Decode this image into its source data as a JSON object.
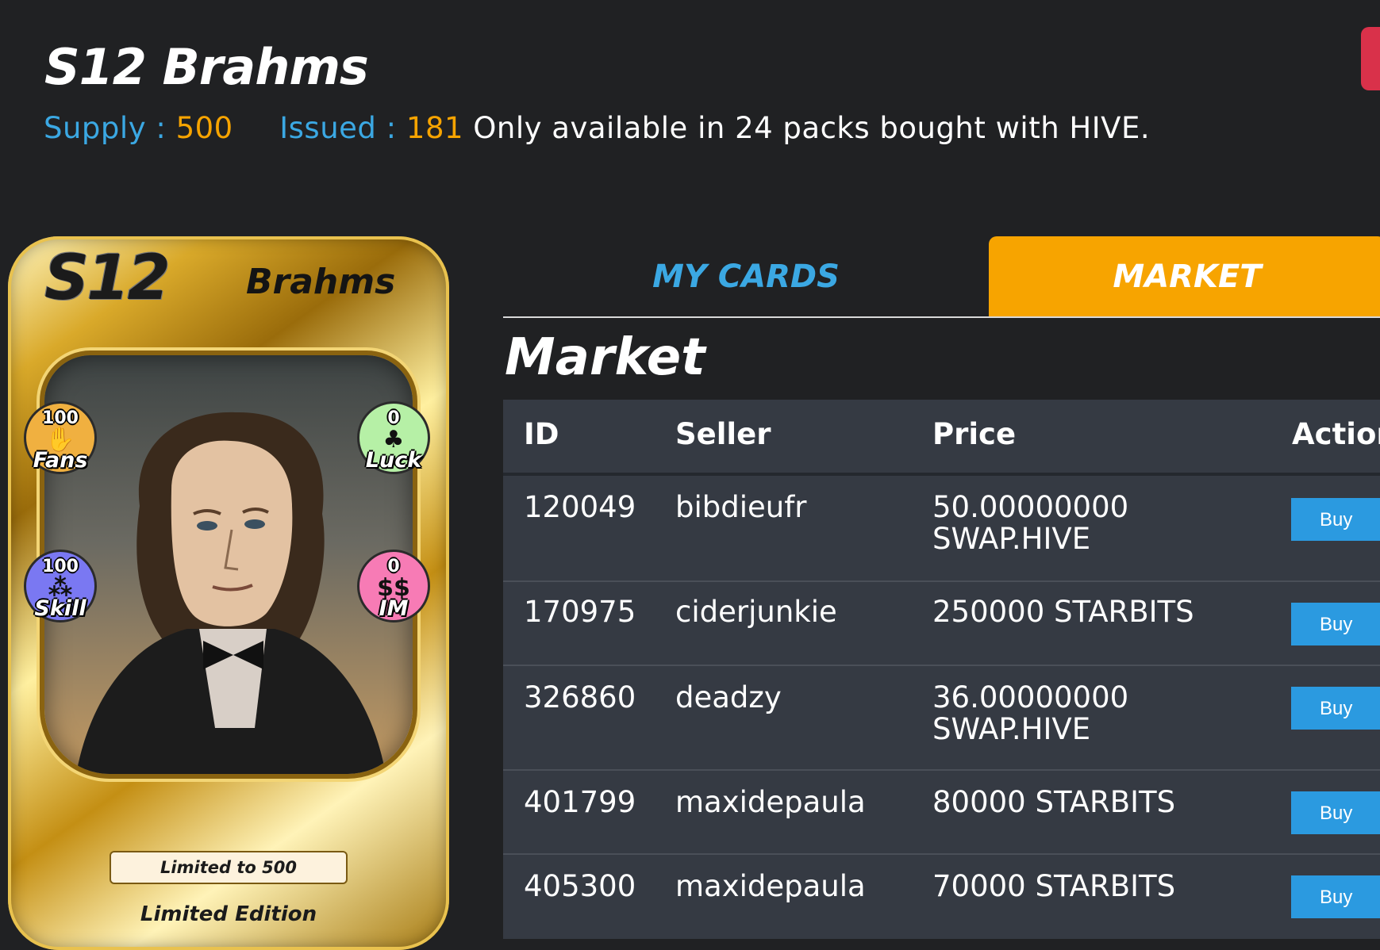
{
  "header": {
    "title": "S12 Brahms",
    "supply_label": "Supply :",
    "supply_value": "500",
    "issued_label": "Issued :",
    "issued_value": "181",
    "description": "Only available in 24 packs bought with HIVE."
  },
  "card": {
    "set": "S12",
    "name": "Brahms",
    "stats": {
      "fans": {
        "value": "100",
        "label": "Fans",
        "icon": "crowd-icon",
        "color": "#f0b040"
      },
      "luck": {
        "value": "0",
        "label": "Luck",
        "icon": "clover-icon",
        "color": "#b6f0a6"
      },
      "skill": {
        "value": "100",
        "label": "Skill",
        "icon": "juggler-icon",
        "color": "#7a78f2"
      },
      "im": {
        "value": "0",
        "label": "IM",
        "icon": "dollar-icon",
        "color": "#f77bb5"
      }
    },
    "limited_text": "Limited to 500",
    "edition": "Limited Edition"
  },
  "tabs": {
    "my_cards": "MY CARDS",
    "market": "MARKET"
  },
  "market": {
    "heading": "Market",
    "columns": [
      "ID",
      "Seller",
      "Price",
      "Action"
    ],
    "rows": [
      {
        "id": "120049",
        "seller": "bibdieufr",
        "price_line1": "50.00000000",
        "price_line2": "SWAP.HIVE",
        "action": "Buy"
      },
      {
        "id": "170975",
        "seller": "ciderjunkie",
        "price_line1": "250000 STARBITS",
        "price_line2": "",
        "action": "Buy"
      },
      {
        "id": "326860",
        "seller": "deadzy",
        "price_line1": "36.00000000",
        "price_line2": "SWAP.HIVE",
        "action": "Buy"
      },
      {
        "id": "401799",
        "seller": "maxidepaula",
        "price_line1": "80000 STARBITS",
        "price_line2": "",
        "action": "Buy"
      },
      {
        "id": "405300",
        "seller": "maxidepaula",
        "price_line1": "70000 STARBITS",
        "price_line2": "",
        "action": "Buy"
      }
    ]
  },
  "colors": {
    "background": "#202123",
    "accent_blue": "#3ba8e3",
    "accent_orange": "#f7a400",
    "buy_button": "#2b9ae0",
    "table_bg": "#353a43"
  }
}
